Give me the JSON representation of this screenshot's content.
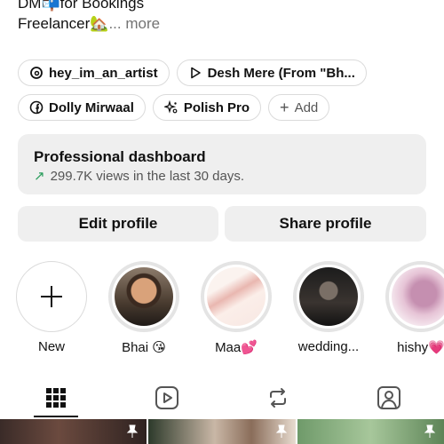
{
  "bio": {
    "line1": "DM📬for Bookings",
    "line2": "Freelancer🏡",
    "more": "... more"
  },
  "chips": {
    "threads": "hey_im_an_artist",
    "music": "Desh Mere (From \"Bh...",
    "facebook": "Dolly Mirwaal",
    "app": "Polish Pro",
    "add": "Add"
  },
  "dashboard": {
    "title": "Professional dashboard",
    "stat": "299.7K views in the last 30 days."
  },
  "buttons": {
    "edit": "Edit profile",
    "share": "Share profile"
  },
  "highlights": [
    {
      "label": "New"
    },
    {
      "label": "Bhai 😘"
    },
    {
      "label": "Maa💕"
    },
    {
      "label": "wedding..."
    },
    {
      "label": "hishy💗"
    }
  ],
  "tabs": [
    "grid-icon",
    "reels-icon",
    "reposts-icon",
    "tagged-icon"
  ],
  "colors": {
    "accent_green": "#2a9d5c",
    "chip_border": "#dbdbdb",
    "button_bg": "#efefef"
  }
}
